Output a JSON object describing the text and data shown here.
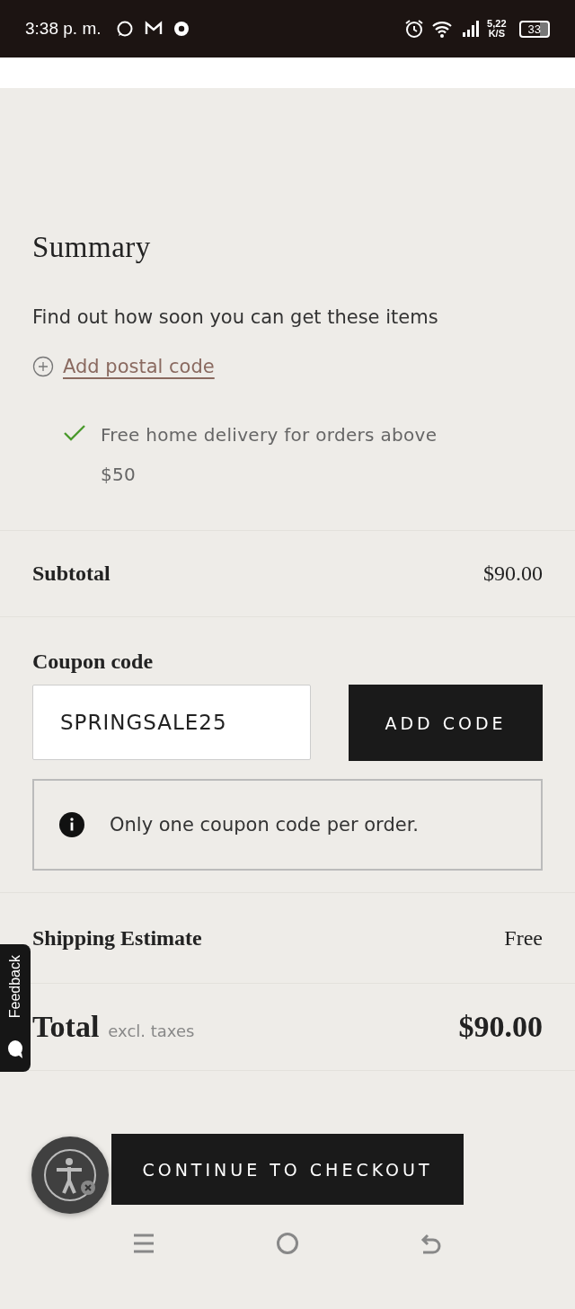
{
  "status_bar": {
    "time": "3:38 p. m.",
    "speed": "5,22",
    "speed_unit": "K/S",
    "battery": "33"
  },
  "summary": {
    "title": "Summary",
    "delivery_prompt": "Find out how soon you can get these items",
    "postal_link": "Add postal code",
    "perk": "Free home delivery for orders above $50"
  },
  "subtotal": {
    "label": "Subtotal",
    "value": "$90.00"
  },
  "coupon": {
    "label": "Coupon code",
    "value": "SPRINGSALE25",
    "button": "ADD CODE",
    "note": "Only one coupon code per order."
  },
  "shipping": {
    "label": "Shipping Estimate",
    "value": "Free"
  },
  "total": {
    "label": "Total",
    "note": "excl. taxes",
    "value": "$90.00"
  },
  "checkout_button": "CONTINUE TO CHECKOUT",
  "feedback_tab": "Feedback"
}
